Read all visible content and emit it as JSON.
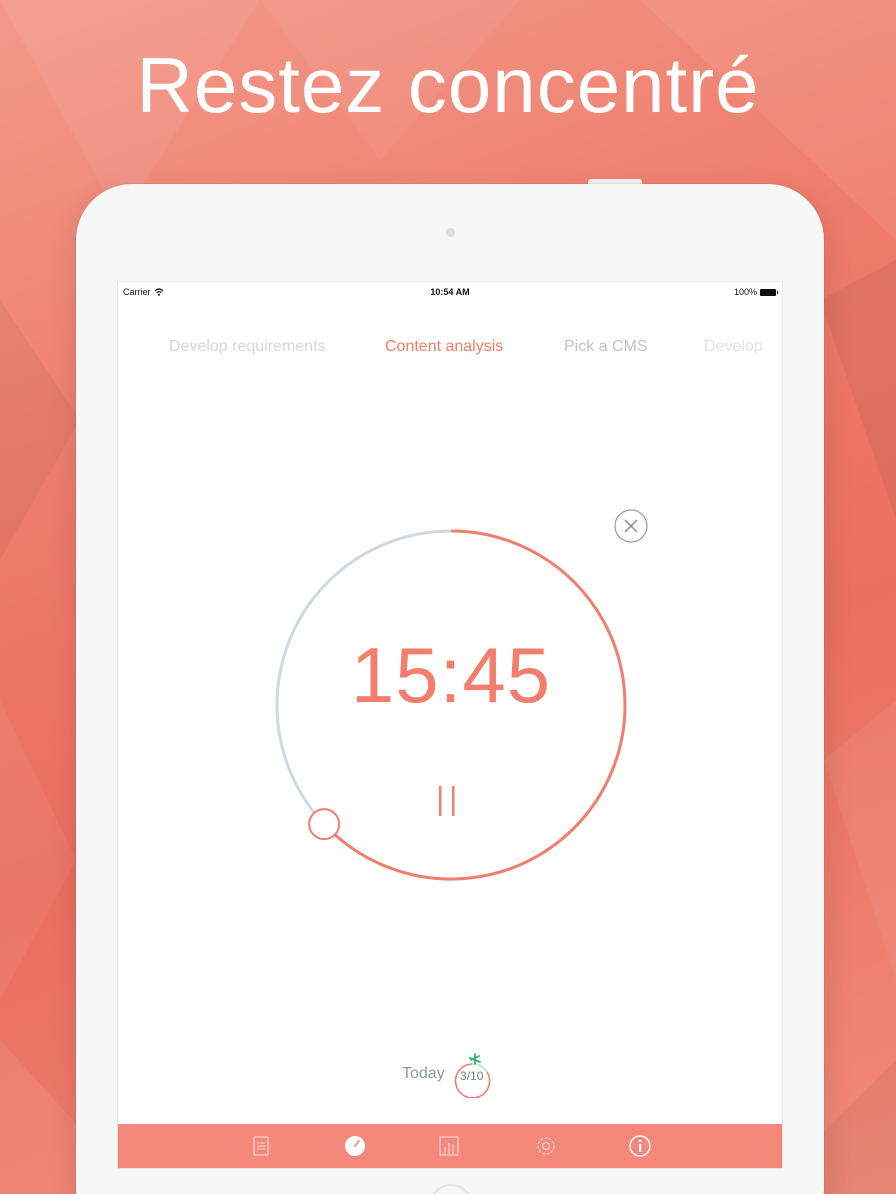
{
  "headline": "Restez concentré",
  "status_bar": {
    "carrier": "Carrier",
    "time": "10:54 AM",
    "battery": "100%"
  },
  "tasks": [
    {
      "label": "Develop requirements",
      "state": "previous"
    },
    {
      "label": "Content analysis",
      "state": "active"
    },
    {
      "label": "Pick a CMS",
      "state": "next"
    },
    {
      "label": "Develop",
      "state": "next-partial"
    }
  ],
  "timer": {
    "time": "15:45",
    "progress": 0.37,
    "state": "running"
  },
  "today": {
    "label": "Today",
    "count": "3/10"
  },
  "tab_bar": {
    "items": [
      "list-icon",
      "timer-icon",
      "stats-icon",
      "settings-icon",
      "info-icon"
    ],
    "active": "timer-icon"
  },
  "colors": {
    "accent": "#f27f6d",
    "track": "#cfd9e2",
    "tab_bar": "#f4887a",
    "background": "#ee7b6b"
  }
}
